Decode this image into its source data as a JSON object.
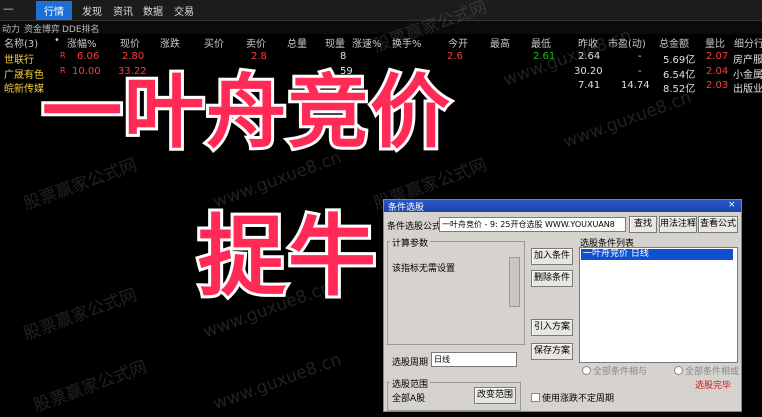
{
  "menubar": {
    "min_glyph": "—",
    "tabs": [
      {
        "label": "行情",
        "active": true
      },
      {
        "label": "发现",
        "active": false
      },
      {
        "label": "资讯",
        "active": false
      },
      {
        "label": "数据",
        "active": false
      },
      {
        "label": "交易",
        "active": false
      }
    ]
  },
  "subbar": {
    "items": [
      "动力",
      "资金博弈",
      "DDE排名"
    ]
  },
  "columns": [
    "名称(3)",
    "•",
    "涨幅%",
    "现价",
    "涨跌",
    "买价",
    "卖价",
    "总量",
    "现量",
    "涨速%",
    "换手%",
    "今开",
    "最高",
    "最低",
    "昨收",
    "市盈(动)",
    "总金额",
    "量比",
    "细分行"
  ],
  "rows": [
    {
      "name": "世联行",
      "flag": "R",
      "change_pct": "6.06",
      "price": "2.80",
      "diff": "",
      "bid": "",
      "ask": "2.8",
      "vol": "",
      "cur_vol": "8",
      "speed": "",
      "turnover": "",
      "open": "2.6",
      "high": "",
      "low": "2.61",
      "prev_close": "2.64",
      "pe": "-",
      "amount": "5.69亿",
      "vol_ratio": "2.07",
      "industry": "房产服"
    },
    {
      "name": "广晟有色",
      "flag": "R",
      "change_pct": "10.00",
      "price": "33.22",
      "diff": "",
      "bid": "",
      "ask": "",
      "vol": "",
      "cur_vol": "59",
      "speed": "",
      "turnover": "",
      "open": "",
      "high": "",
      "low": "",
      "prev_close": "30.20",
      "pe": "-",
      "amount": "6.54亿",
      "vol_ratio": "2.04",
      "industry": "小金属"
    },
    {
      "name": "皖新传媒",
      "flag": "",
      "change_pct": "",
      "price": "",
      "diff": "",
      "bid": "",
      "ask": "",
      "vol": "",
      "cur_vol": "",
      "speed": "",
      "turnover": "",
      "open": "",
      "high": "",
      "low": "",
      "prev_close": "7.41",
      "pe": "14.74",
      "amount": "8.52亿",
      "vol_ratio": "2.03",
      "industry": "出版业"
    }
  ],
  "watermarks": [
    "股票赢家公式网",
    "www.guxue8.cn"
  ],
  "overlay": {
    "title_line1": "一叶舟竞价",
    "title_line2": "捉牛"
  },
  "dialog": {
    "title": "条件选股",
    "close": "×",
    "formula_label": "条件选股公式",
    "formula_value": "一叶舟竞价 - 9: 25开仓选股 WWW.YOUXUAN8",
    "btn_query": "查找",
    "btn_usage": "用法注释",
    "btn_view": "查看公式",
    "params_label": "计算参数",
    "params_note": "该指标无需设置",
    "btn_add": "加入条件",
    "btn_delete": "删除条件",
    "btn_import": "引入方案",
    "btn_save": "保存方案",
    "condition_list_label": "选股条件列表",
    "condition_item": "一叶舟竞价  日线",
    "period_label": "选股周期",
    "period_value": "日线",
    "range_label": "选股范围",
    "range_value": "全部A股",
    "btn_change_range": "改变范围",
    "radio_all_and": "全部条件相与",
    "radio_all_or": "全部条件相或",
    "chk_pre_fq": "使用涨跌不定周期",
    "status": "选股完毕"
  }
}
